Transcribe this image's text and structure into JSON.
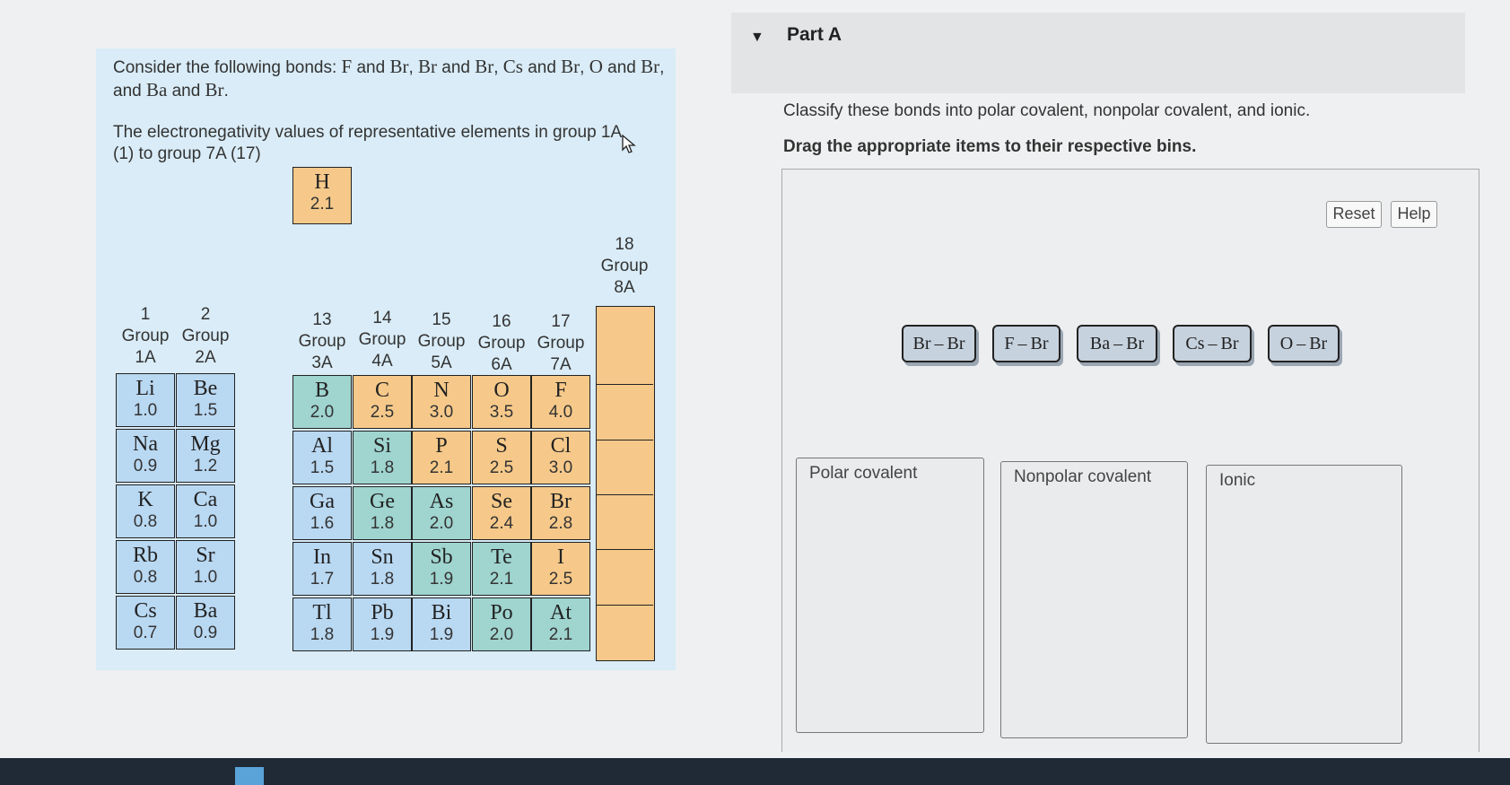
{
  "question": {
    "intro": "Consider the following bonds:",
    "pairs": [
      {
        "a": "F",
        "b": "Br"
      },
      {
        "a": "Br",
        "b": "Br"
      },
      {
        "a": "Cs",
        "b": "Br"
      },
      {
        "a": "O",
        "b": "Br"
      },
      {
        "a": "Ba",
        "b": "Br"
      }
    ],
    "and_word": "and",
    "en_line1": "The electronegativity values of representative elements in group 1A",
    "en_line2": "(1) to group 7A (17)"
  },
  "table": {
    "hydrogen": {
      "sym": "H",
      "en": "2.1"
    },
    "group18": {
      "num": "18",
      "word": "Group",
      "name": "8A"
    },
    "groups": [
      {
        "num": "1",
        "word": "Group",
        "name": "1A"
      },
      {
        "num": "2",
        "word": "Group",
        "name": "2A"
      },
      {
        "num": "13",
        "word": "Group",
        "name": "3A"
      },
      {
        "num": "14",
        "word": "Group",
        "name": "4A"
      },
      {
        "num": "15",
        "word": "Group",
        "name": "5A"
      },
      {
        "num": "16",
        "word": "Group",
        "name": "6A"
      },
      {
        "num": "17",
        "word": "Group",
        "name": "7A"
      }
    ],
    "rows": [
      [
        {
          "sym": "Li",
          "en": "1.0",
          "c": "blue"
        },
        {
          "sym": "Be",
          "en": "1.5",
          "c": "blue"
        },
        {
          "sym": "B",
          "en": "2.0",
          "c": "green"
        },
        {
          "sym": "C",
          "en": "2.5",
          "c": "orange"
        },
        {
          "sym": "N",
          "en": "3.0",
          "c": "orange"
        },
        {
          "sym": "O",
          "en": "3.5",
          "c": "orange"
        },
        {
          "sym": "F",
          "en": "4.0",
          "c": "orange"
        }
      ],
      [
        {
          "sym": "Na",
          "en": "0.9",
          "c": "blue"
        },
        {
          "sym": "Mg",
          "en": "1.2",
          "c": "blue"
        },
        {
          "sym": "Al",
          "en": "1.5",
          "c": "blue"
        },
        {
          "sym": "Si",
          "en": "1.8",
          "c": "green"
        },
        {
          "sym": "P",
          "en": "2.1",
          "c": "orange"
        },
        {
          "sym": "S",
          "en": "2.5",
          "c": "orange"
        },
        {
          "sym": "Cl",
          "en": "3.0",
          "c": "orange"
        }
      ],
      [
        {
          "sym": "K",
          "en": "0.8",
          "c": "blue"
        },
        {
          "sym": "Ca",
          "en": "1.0",
          "c": "blue"
        },
        {
          "sym": "Ga",
          "en": "1.6",
          "c": "blue"
        },
        {
          "sym": "Ge",
          "en": "1.8",
          "c": "green"
        },
        {
          "sym": "As",
          "en": "2.0",
          "c": "green"
        },
        {
          "sym": "Se",
          "en": "2.4",
          "c": "orange"
        },
        {
          "sym": "Br",
          "en": "2.8",
          "c": "orange"
        }
      ],
      [
        {
          "sym": "Rb",
          "en": "0.8",
          "c": "blue"
        },
        {
          "sym": "Sr",
          "en": "1.0",
          "c": "blue"
        },
        {
          "sym": "In",
          "en": "1.7",
          "c": "blue"
        },
        {
          "sym": "Sn",
          "en": "1.8",
          "c": "blue"
        },
        {
          "sym": "Sb",
          "en": "1.9",
          "c": "green"
        },
        {
          "sym": "Te",
          "en": "2.1",
          "c": "green"
        },
        {
          "sym": "I",
          "en": "2.5",
          "c": "orange"
        }
      ],
      [
        {
          "sym": "Cs",
          "en": "0.7",
          "c": "blue"
        },
        {
          "sym": "Ba",
          "en": "0.9",
          "c": "blue"
        },
        {
          "sym": "Tl",
          "en": "1.8",
          "c": "blue"
        },
        {
          "sym": "Pb",
          "en": "1.9",
          "c": "blue"
        },
        {
          "sym": "Bi",
          "en": "1.9",
          "c": "blue"
        },
        {
          "sym": "Po",
          "en": "2.0",
          "c": "green"
        },
        {
          "sym": "At",
          "en": "2.1",
          "c": "green"
        }
      ]
    ]
  },
  "part": {
    "title": "Part A",
    "instruction": "Classify these bonds into polar covalent, nonpolar covalent, and ionic.",
    "drag_instruction": "Drag the appropriate items to their respective bins.",
    "reset_label": "Reset",
    "help_label": "Help",
    "items": [
      "Br – Br",
      "F – Br",
      "Ba – Br",
      "Cs – Br",
      "O – Br"
    ],
    "bins": [
      "Polar covalent",
      "Nonpolar covalent",
      "Ionic"
    ]
  },
  "colors": {
    "blue": "#b9d8f2",
    "orange": "#f6c98a",
    "green": "#9fd4cf",
    "panel": "#d9ecf7"
  }
}
